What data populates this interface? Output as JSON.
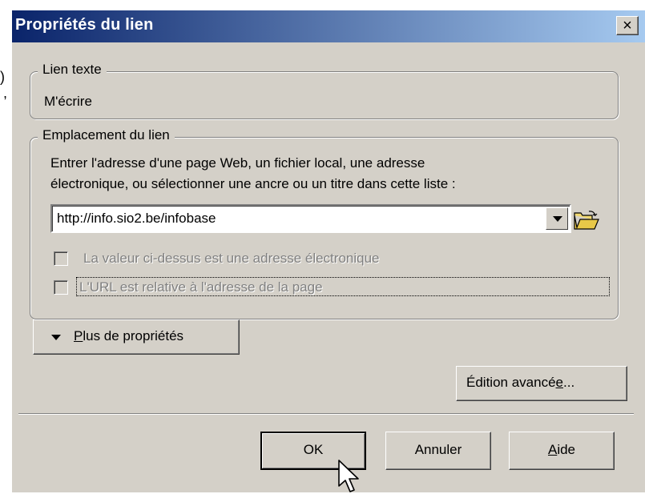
{
  "window": {
    "title": "Propriétés du lien",
    "close_label": "×"
  },
  "text_group": {
    "legend": "Lien texte",
    "value": "M'écrire"
  },
  "location_group": {
    "legend": "Emplacement du lien",
    "instruction_line1": "Entrer l'adresse d'une page Web, un fichier local, une adresse",
    "instruction_line2": "électronique, ou sélectionner une ancre ou un titre dans cette liste :",
    "url_value": "http://info.sio2.be/infobase",
    "checkbox_email_label": "La valeur ci-dessus est une adresse électronique",
    "checkbox_relative_label": "L'URL est relative à l'adresse de la page"
  },
  "more_properties": {
    "label_prefix": "",
    "underlined": "P",
    "label_rest": "lus de propriétés"
  },
  "advanced_edit": {
    "label_prefix": "Édition avancé",
    "underlined": "e",
    "label_rest": "..."
  },
  "buttons": {
    "ok": "OK",
    "cancel": "Annuler",
    "help_underlined": "A",
    "help_rest": "ide"
  },
  "stray": {
    "top_char": ")",
    "mid_char": ","
  },
  "icons": [
    "close-icon",
    "dropdown-arrow-icon",
    "folder-open-icon",
    "triangle-down-icon",
    "mouse-pointer-icon"
  ]
}
